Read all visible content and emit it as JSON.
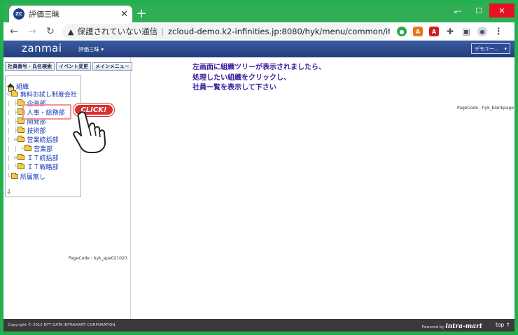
{
  "browser": {
    "tab_title": "評価三昧",
    "favicon_text": "ZC",
    "insecure_label": "保護されていない通信",
    "separator": "|",
    "url": "zcloud-demo.k2-infinities.jp:8080/hyk/menu/common/if···"
  },
  "app": {
    "logo": "zanmai",
    "user_menu": "評価三昧 ▾",
    "select_value": "デモユー...",
    "left_tabs": [
      "社員番号・氏名検索",
      "イベント変更",
      "メインメニュー"
    ],
    "tree_root": "組織",
    "tree": [
      {
        "guide": "⊖",
        "label": "無料お試し制度会社"
      },
      {
        "guide": "|  ├",
        "label": "企画部"
      },
      {
        "guide": "|  ├",
        "label": "人事・総務部"
      },
      {
        "guide": "|  ├",
        "label": "開発部"
      },
      {
        "guide": "|  ├",
        "label": "技術部"
      },
      {
        "guide": "|  ⊖",
        "label": "営業統括部"
      },
      {
        "guide": "|  |  └",
        "label": "営業部"
      },
      {
        "guide": "|  ⊖",
        "label": "ＩＴ統括部"
      },
      {
        "guide": "|     └",
        "label": "ＩＴ戦略部"
      },
      {
        "guide": "└",
        "label": "所属無し"
      }
    ],
    "pagecode_left": "PageCode : hyk_ape021020",
    "pagecode_right": "PageCode : hyk_blankpage",
    "main_message": [
      "左画面に組織ツリーが表示されましたら、",
      "処理したい組織をクリックし、",
      "社員一覧を表示して下さい"
    ],
    "click_badge": "CLICK!",
    "footer_copyright": "Copyright © 2012 NTT DATA INTRAMART CORPORATION.",
    "footer_powered": "Powered by",
    "footer_brand": "intra-mart",
    "footer_top": "top ↑"
  }
}
